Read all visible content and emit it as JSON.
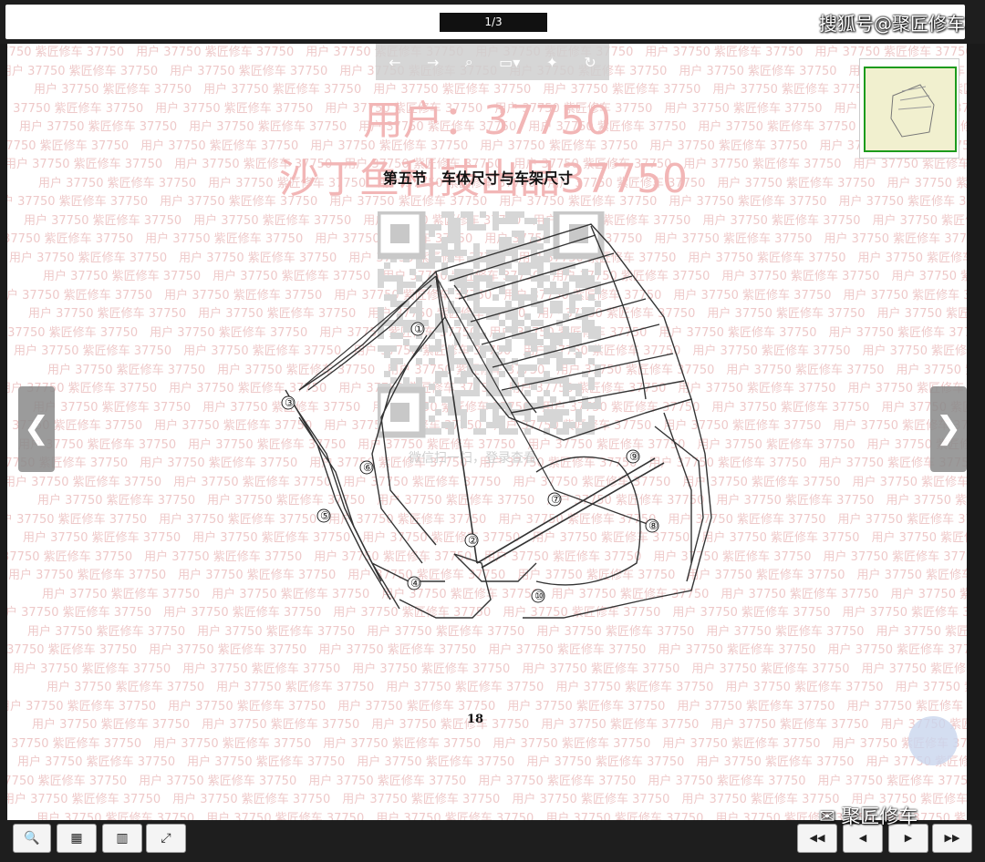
{
  "viewer": {
    "page_indicator": "1/3",
    "toolbar_icons": [
      "prev-arrow-icon",
      "next-arrow-icon",
      "zoom-icon",
      "fit-page-icon",
      "pointer-icon",
      "rotate-icon"
    ]
  },
  "watermarks": {
    "sohu": "搜狐号@聚匠修车",
    "big_line_1": "用户：37750",
    "big_line_2": "沙丁鱼科技出品37750",
    "repeat_text": "用户 37750 紫匠修车 37750",
    "wechat_scan": "微信扫一扫，登录查看",
    "gzh": "聚匠修车"
  },
  "document": {
    "section_title": "第五节　车体尺寸与车架尺寸",
    "page_number": "18",
    "callouts": [
      "①",
      "②",
      "③",
      "④",
      "⑤",
      "⑥",
      "⑦",
      "⑧",
      "⑨",
      "⑩"
    ]
  },
  "navigation": {
    "prev": "❮",
    "next": "❯"
  },
  "bottom_toolbar": {
    "zoom": "🔍",
    "grid": "▦",
    "book": "▥",
    "fullscreen": "⤢",
    "first": "◀◀",
    "prev": "◀",
    "next": "▶",
    "last": "▶▶"
  },
  "colors": {
    "watermark_red": "#e9b7b7",
    "thumb_border": "#1c9b1c",
    "frame_dark": "#1e1e1e"
  }
}
